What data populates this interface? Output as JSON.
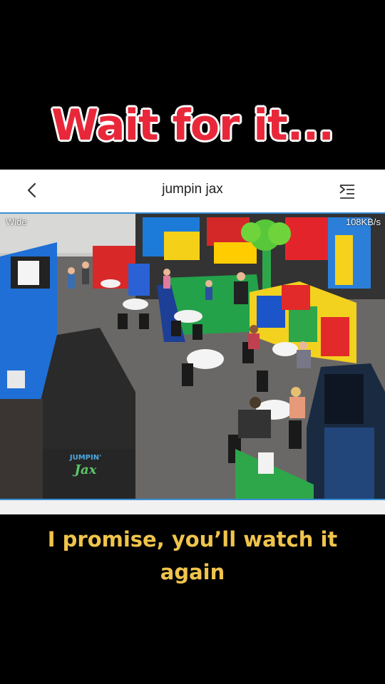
{
  "overlay": {
    "headline": "Wait for it...",
    "caption": "I promise, you’ll watch it again"
  },
  "app": {
    "title": "jumpin jax",
    "back_icon": "chevron-left-icon",
    "menu_icon": "menu-list-icon"
  },
  "camera": {
    "mode_label": "Wide",
    "bitrate_label": "108KB/s",
    "logo_text": "JUMPIN' Jax"
  },
  "colors": {
    "headline": "#e8283a",
    "caption": "#f0c44c",
    "feed_border": "#3a8fd6"
  }
}
